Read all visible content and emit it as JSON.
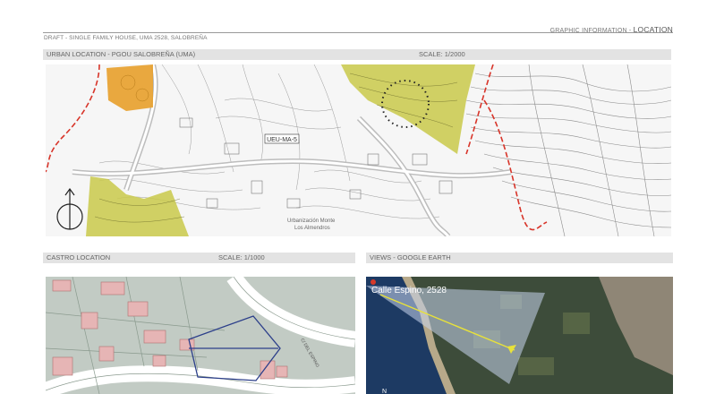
{
  "header": {
    "section_prefix": "GRAPHIC INFORMATION - ",
    "section_title": "LOCATION",
    "subtitle": "DRAFT - SINGLE FAMILY HOUSE, UMA 2528, SALOBREÑA"
  },
  "urban": {
    "title": "URBAN LOCATION - PGOU SALOBREÑA (UMA)",
    "scale": "SCALE: 1/2000",
    "map_label": "UEU-MA-5",
    "map_text_1": "Urbanización Monte",
    "map_text_2": "Los Almendros",
    "colors": {
      "orange_zone": "#e8a02b",
      "yellow_zone": "#c9c94a",
      "boundary": "#d8352a"
    }
  },
  "castro": {
    "title": "CASTRO LOCATION",
    "scale": "SCALE: 1/1000",
    "colors": {
      "ground": "#c2cbc4",
      "building": "#e6b5b5",
      "parcel": "#2c3f8a"
    }
  },
  "earth": {
    "title": "VIEWS - GOOGLE EARTH",
    "place_label": "Calle Espino, 2528",
    "north_label": "N",
    "colors": {
      "view_cone": "#c8d6ee",
      "marker": "#e8e23a"
    }
  }
}
